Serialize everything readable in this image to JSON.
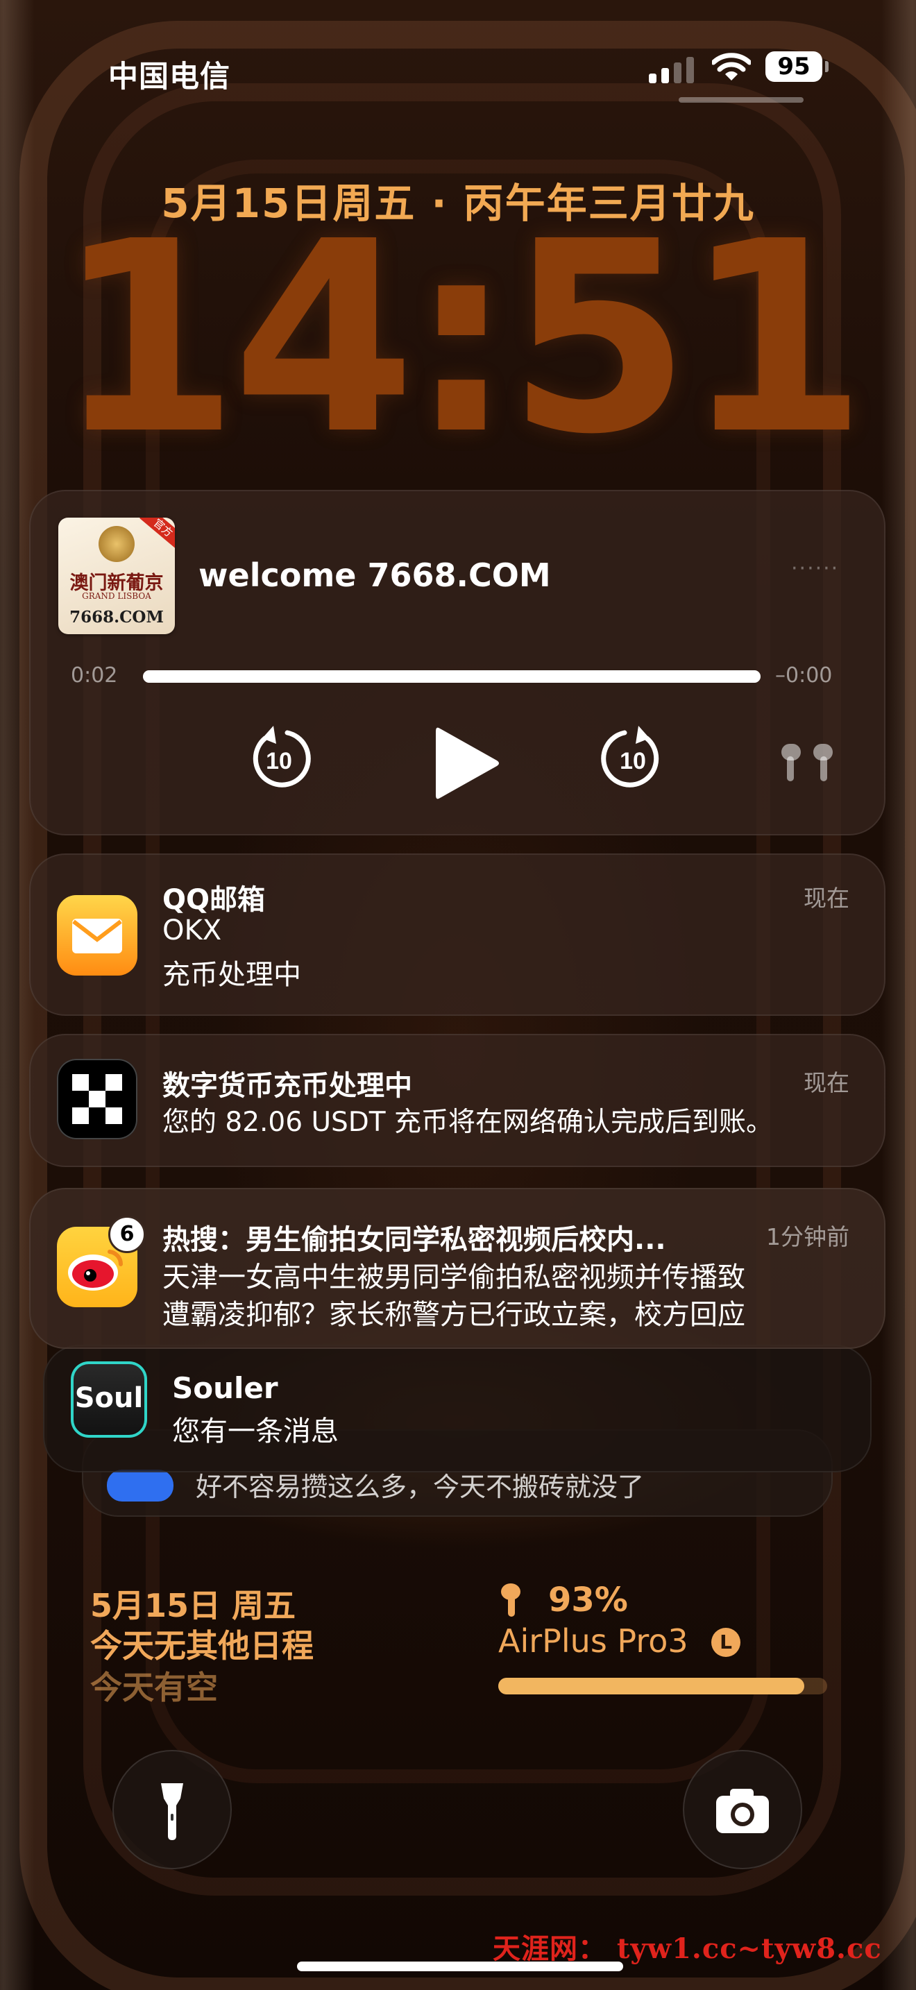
{
  "status_bar": {
    "carrier": "中国电信",
    "battery": "95"
  },
  "lock": {
    "date_line": "5月15日周五 · 丙午年三月廿九",
    "time": "14:51"
  },
  "media": {
    "art_title": "澳门新葡京",
    "art_subtitle": "GRAND LISBOA",
    "art_domain": "7668.COM",
    "art_tag": "官方",
    "title": "welcome 7668.COM",
    "elapsed": "0:02",
    "remaining": "–0:00",
    "progress": 1.0,
    "skip_back_seconds": "10",
    "skip_forward_seconds": "10"
  },
  "notifications": [
    {
      "app": "QQ邮箱",
      "title": "QQ邮箱",
      "line1": "OKX",
      "line2": "充币处理中",
      "time": "现在",
      "icon": "mail-icon"
    },
    {
      "app": "OKX",
      "title": "数字货币充币处理中",
      "line1": "您的 82.06 USDT 充币将在网络确认完成后到账。",
      "time": "现在",
      "icon": "okx-logo-icon"
    },
    {
      "app": "微博",
      "title": "热搜：男生偷拍女同学私密视频后校内...",
      "line1": "天津一女高中生被男同学偷拍私密视频并传播致",
      "line2": "遭霸凌抑郁？家长称警方已行政立案，校方回应",
      "time": "1分钟前",
      "badge": "6",
      "icon": "weibo-icon"
    }
  ],
  "stacked": [
    {
      "title": "Souler",
      "body": "您有一条消息",
      "icon": "soul-icon"
    },
    {
      "body": "好不容易攒这么多，今天不搬砖就没了",
      "icon": "app-icon"
    }
  ],
  "widgets": {
    "calendar": {
      "date": "5月15日 周五",
      "schedule": "今天无其他日程",
      "free": "今天有空"
    },
    "airpods": {
      "percent": "93%",
      "name": "AirPlus Pro3",
      "badge": "L",
      "level": 0.93
    }
  },
  "watermark": "天涯网： tyw1.cc~tyw8.cc",
  "colors": {
    "accent": "#f1a85a",
    "time": "#8a3d0a",
    "watermark": "#e0231c"
  }
}
